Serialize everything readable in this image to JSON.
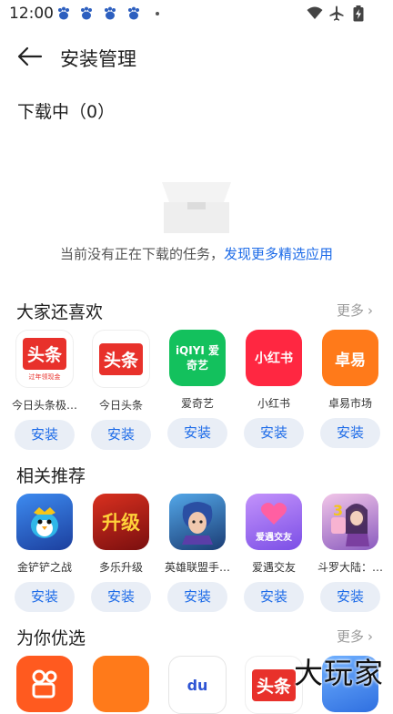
{
  "status": {
    "time": "12:00"
  },
  "header": {
    "title": "安装管理"
  },
  "download": {
    "heading": "下载中（0）",
    "empty_text": "当前没有正在下载的任务，",
    "empty_link": "发现更多精选应用"
  },
  "sections": [
    {
      "title": "大家还喜欢",
      "more": "更多",
      "apps": [
        {
          "name": "今日头条极…",
          "icon_text": "头条",
          "icon_sub": "过年领现金",
          "icon": "toutiao-lite-icon",
          "color": "#e8312b"
        },
        {
          "name": "今日头条",
          "icon_text": "头条",
          "icon": "toutiao-icon",
          "color": "#e8312b"
        },
        {
          "name": "爱奇艺",
          "icon_text": "iQIYI 爱奇艺",
          "icon": "iqiyi-icon",
          "color": "#13c15d"
        },
        {
          "name": "小红书",
          "icon_text": "小红书",
          "icon": "xiaohongshu-icon",
          "color": "#ff2741"
        },
        {
          "name": "卓易市场",
          "icon_text": "卓易",
          "icon": "zhuoyi-market-icon",
          "color": "#ff7a1a"
        }
      ]
    },
    {
      "title": "相关推荐",
      "apps": [
        {
          "name": "金铲铲之战",
          "icon": "jinchanchan-icon",
          "color": "#2e5fd6"
        },
        {
          "name": "多乐升级",
          "icon_text": "升级",
          "icon": "duole-shengji-icon",
          "color": "#b81c1c"
        },
        {
          "name": "英雄联盟手…",
          "icon": "lol-mobile-icon",
          "color": "#2a6fb3"
        },
        {
          "name": "爱遇交友",
          "icon_text": "爱遇交友",
          "icon": "aiyu-dating-icon",
          "color": "#9b6df5"
        },
        {
          "name": "斗罗大陆：…",
          "icon": "douluo-icon",
          "color": "#c28fd1"
        }
      ]
    },
    {
      "title": "为你优选",
      "more": "更多",
      "apps": [
        {
          "name": "",
          "icon": "kuaishou-icon",
          "color": "#ff5a1f"
        },
        {
          "name": "",
          "icon": "zhuoyi-market-icon",
          "color": "#ff7a1a"
        },
        {
          "name": "",
          "icon_text": "du",
          "icon": "baidu-icon",
          "color": "#ffffff"
        },
        {
          "name": "",
          "icon_text": "头条",
          "icon": "toutiao-icon",
          "color": "#e8312b"
        },
        {
          "name": "",
          "icon": "app-icon",
          "color": "#3d7ef0"
        }
      ]
    }
  ],
  "install_label": "安装",
  "watermark": "大玩家"
}
